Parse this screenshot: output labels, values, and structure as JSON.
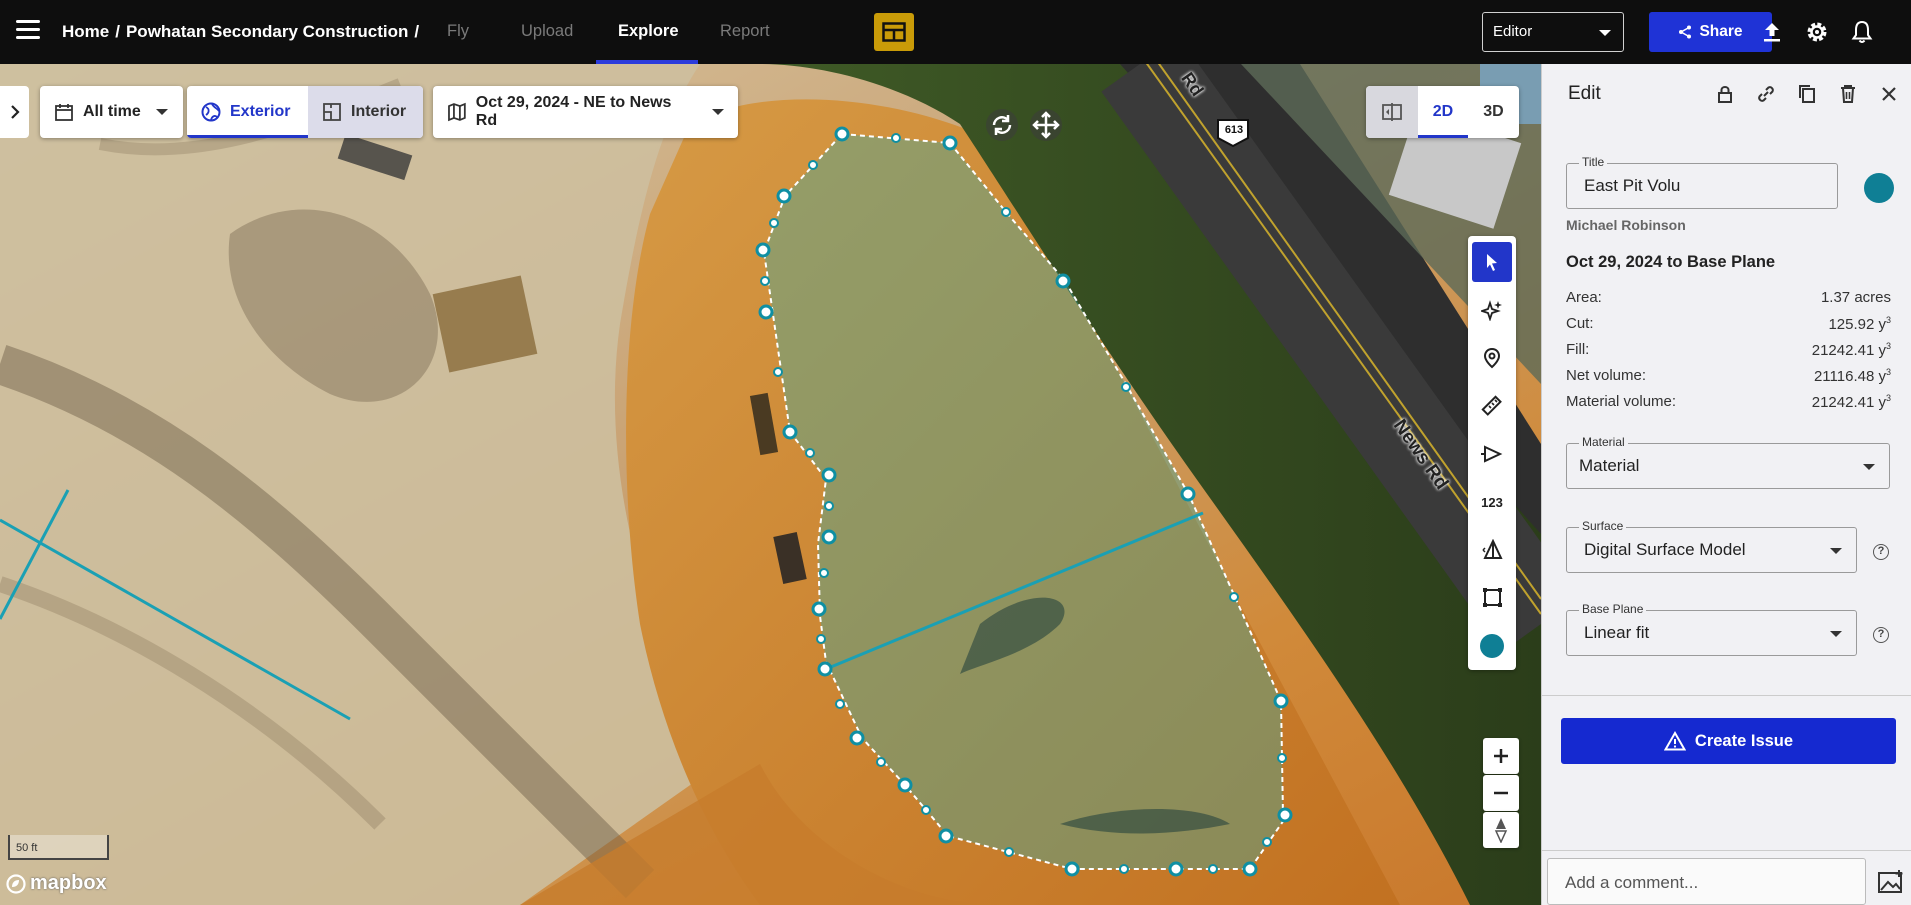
{
  "nav": {
    "breadcrumb_home": "Home",
    "breadcrumb_sep": "/",
    "breadcrumb_project": "Powhatan Secondary Construction",
    "breadcrumb_trail": "/",
    "tabs": [
      {
        "label": "Fly",
        "active": false
      },
      {
        "label": "Upload",
        "active": false
      },
      {
        "label": "Explore",
        "active": true
      },
      {
        "label": "Report",
        "active": false
      }
    ],
    "role": "Editor",
    "share_label": "Share",
    "icons": [
      "menu-icon",
      "layout-icon",
      "share-icon",
      "upload-icon",
      "settings-icon",
      "notifications-icon"
    ]
  },
  "map": {
    "time_filter": "All time",
    "view_modes": [
      "Exterior",
      "Interior"
    ],
    "active_view_mode": "Exterior",
    "dataset": "Oct 29, 2024 - NE to News Rd",
    "dimension_modes": [
      "2D",
      "3D"
    ],
    "active_dimension": "2D",
    "road_labels": [
      "News Rd",
      "Rd"
    ],
    "route_shield": "613",
    "scale_label": "50 ft",
    "attribution": "mapbox",
    "tool_number_label": "123",
    "polygon_color": "#0f8fa3",
    "accent_color": "#2236c9"
  },
  "panel": {
    "header": "Edit",
    "title_label": "Title",
    "title_value": "East Pit Volu",
    "color_swatch": "#0f7f95",
    "author": "Michael Robinson",
    "comparison": "Oct 29, 2024 to Base Plane",
    "stats": [
      {
        "label": "Area:",
        "value": "1.37 acres",
        "cubic": false
      },
      {
        "label": "Cut:",
        "value": "125.92 y",
        "cubic": true
      },
      {
        "label": "Fill:",
        "value": "21242.41 y",
        "cubic": true
      },
      {
        "label": "Net volume:",
        "value": "21116.48 y",
        "cubic": true
      },
      {
        "label": "Material volume:",
        "value": "21242.41 y",
        "cubic": true
      }
    ],
    "cubic_sup": "3",
    "material_label": "Material",
    "material_value": "Material",
    "surface_label": "Surface",
    "surface_value": "Digital Surface Model",
    "base_plane_label": "Base Plane",
    "base_plane_value": "Linear fit",
    "help_glyph": "?",
    "create_issue_label": "Create Issue",
    "comment_placeholder": "Add a comment..."
  }
}
